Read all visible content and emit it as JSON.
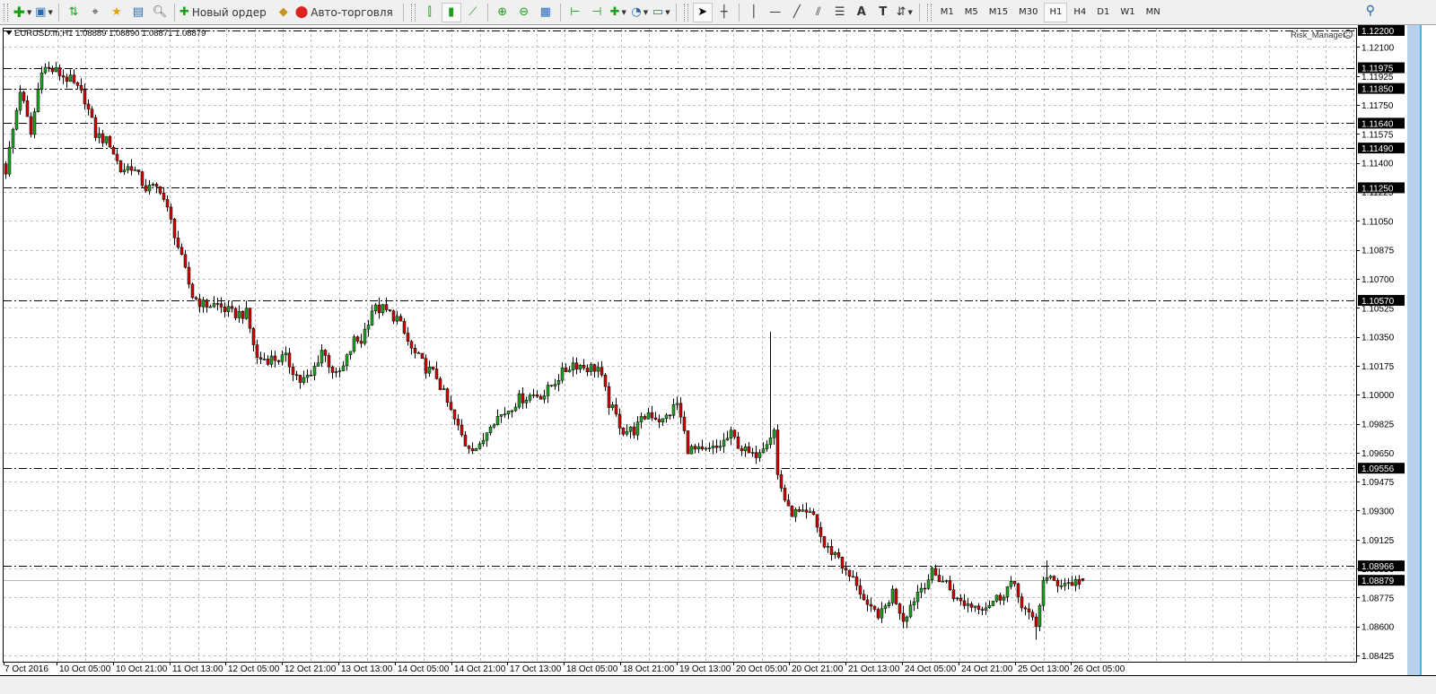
{
  "toolbar": {
    "new_order_label": "Новый ордер",
    "auto_trading_label": "Авто-торговля",
    "timeframes": [
      "M1",
      "M5",
      "M15",
      "M30",
      "H1",
      "H4",
      "D1",
      "W1",
      "MN"
    ],
    "active_timeframe": "H1"
  },
  "chart": {
    "header": "EURUSD.m,H1  1.08889 1.08890 1.08871 1.08879",
    "indicator_label": "Risk_Manager",
    "indicator_status_icon": "frown-face-icon",
    "bid_price": 1.08879,
    "bid_label": "1.08879",
    "colors": {
      "bull": "#1fa31f",
      "bear": "#d00000",
      "wick": "#000000",
      "grid": "#c0c0c0",
      "level": "#000000",
      "bid_line": "#b8b8b8"
    }
  },
  "price_axis": {
    "max": 1.122,
    "min": 1.08425,
    "ticks": [
      "1.12100",
      "1.11925",
      "1.11750",
      "1.11575",
      "1.11400",
      "1.11225",
      "1.11050",
      "1.10875",
      "1.10700",
      "1.10525",
      "1.10350",
      "1.10175",
      "1.10000",
      "1.09825",
      "1.09650",
      "1.09475",
      "1.09300",
      "1.09125",
      "1.08950",
      "1.08775",
      "1.08600",
      "1.08425"
    ],
    "levels": [
      "1.12200",
      "1.11975",
      "1.11850",
      "1.11640",
      "1.11490",
      "1.11250",
      "1.10570",
      "1.09556",
      "1.08966"
    ]
  },
  "time_axis": {
    "labels": [
      "7 Oct 2016",
      "10 Oct 05:00",
      "10 Oct 21:00",
      "11 Oct 13:00",
      "12 Oct 05:00",
      "12 Oct 21:00",
      "13 Oct 13:00",
      "14 Oct 05:00",
      "14 Oct 21:00",
      "17 Oct 13:00",
      "18 Oct 05:00",
      "18 Oct 21:00",
      "19 Oct 13:00",
      "20 Oct 05:00",
      "20 Oct 21:00",
      "21 Oct 13:00",
      "24 Oct 05:00",
      "24 Oct 21:00",
      "25 Oct 13:00",
      "26 Oct 05:00"
    ]
  },
  "chart_data": {
    "type": "candlestick",
    "symbol": "EURUSD.m",
    "timeframe": "H1",
    "note": "close price path by H1 bar index (approximate waypoints)",
    "path": [
      [
        0,
        1.11355
      ],
      [
        4,
        1.11843
      ],
      [
        7,
        1.11572
      ],
      [
        10,
        1.11978
      ],
      [
        14,
        1.11951
      ],
      [
        18,
        1.11897
      ],
      [
        22,
        1.11788
      ],
      [
        25,
        1.11572
      ],
      [
        29,
        1.11518
      ],
      [
        32,
        1.11355
      ],
      [
        35,
        1.11382
      ],
      [
        39,
        1.11247
      ],
      [
        43,
        1.11247
      ],
      [
        47,
        1.10976
      ],
      [
        49,
        1.10813
      ],
      [
        52,
        1.10597
      ],
      [
        55,
        1.10543
      ],
      [
        59,
        1.10543
      ],
      [
        63,
        1.10489
      ],
      [
        67,
        1.10489
      ],
      [
        70,
        1.10218
      ],
      [
        74,
        1.10218
      ],
      [
        78,
        1.10218
      ],
      [
        82,
        1.10082
      ],
      [
        85,
        1.10109
      ],
      [
        88,
        1.10272
      ],
      [
        92,
        1.10109
      ],
      [
        94,
        1.10163
      ],
      [
        97,
        1.10326
      ],
      [
        99,
        1.10326
      ],
      [
        102,
        1.10516
      ],
      [
        105,
        1.10516
      ],
      [
        109,
        1.10461
      ],
      [
        113,
        1.10272
      ],
      [
        117,
        1.10163
      ],
      [
        120,
        1.10109
      ],
      [
        124,
        1.09893
      ],
      [
        128,
        1.09703
      ],
      [
        132,
        1.09676
      ],
      [
        135,
        1.09839
      ],
      [
        139,
        1.09893
      ],
      [
        143,
        1.09974
      ],
      [
        147,
        1.10001
      ],
      [
        150,
        1.10001
      ],
      [
        154,
        1.10109
      ],
      [
        158,
        1.10191
      ],
      [
        162,
        1.10163
      ],
      [
        165,
        1.10163
      ],
      [
        168,
        1.09947
      ],
      [
        172,
        1.09784
      ],
      [
        175,
        1.09784
      ],
      [
        179,
        1.09893
      ],
      [
        183,
        1.09839
      ],
      [
        187,
        1.09947
      ],
      [
        190,
        1.09676
      ],
      [
        194,
        1.09649
      ],
      [
        198,
        1.09676
      ],
      [
        202,
        1.09757
      ],
      [
        205,
        1.09676
      ],
      [
        208,
        1.09622
      ],
      [
        212,
        1.0973
      ],
      [
        214,
        1.09784
      ],
      [
        215,
        1.09514
      ],
      [
        218,
        1.09297
      ],
      [
        222,
        1.0927
      ],
      [
        225,
        1.0927
      ],
      [
        228,
        1.0908
      ],
      [
        232,
        1.09026
      ],
      [
        234,
        1.08918
      ],
      [
        237,
        1.08864
      ],
      [
        240,
        1.08701
      ],
      [
        244,
        1.08674
      ],
      [
        247,
        1.0881
      ],
      [
        250,
        1.08647
      ],
      [
        254,
        1.0881
      ],
      [
        258,
        1.08918
      ],
      [
        262,
        1.08864
      ],
      [
        265,
        1.08755
      ],
      [
        269,
        1.08728
      ],
      [
        273,
        1.08728
      ],
      [
        277,
        1.08782
      ],
      [
        280,
        1.08864
      ],
      [
        284,
        1.08701
      ],
      [
        287,
        1.08593
      ],
      [
        289,
        1.08891
      ],
      [
        293,
        1.08864
      ],
      [
        297,
        1.08864
      ],
      [
        300,
        1.08879
      ]
    ],
    "spikes": [
      [
        213,
        1.1038
      ],
      [
        287,
        1.0852
      ],
      [
        290,
        1.09
      ]
    ],
    "last_ohlc": [
      1.08889,
      1.0889,
      1.08871,
      1.08879
    ]
  }
}
